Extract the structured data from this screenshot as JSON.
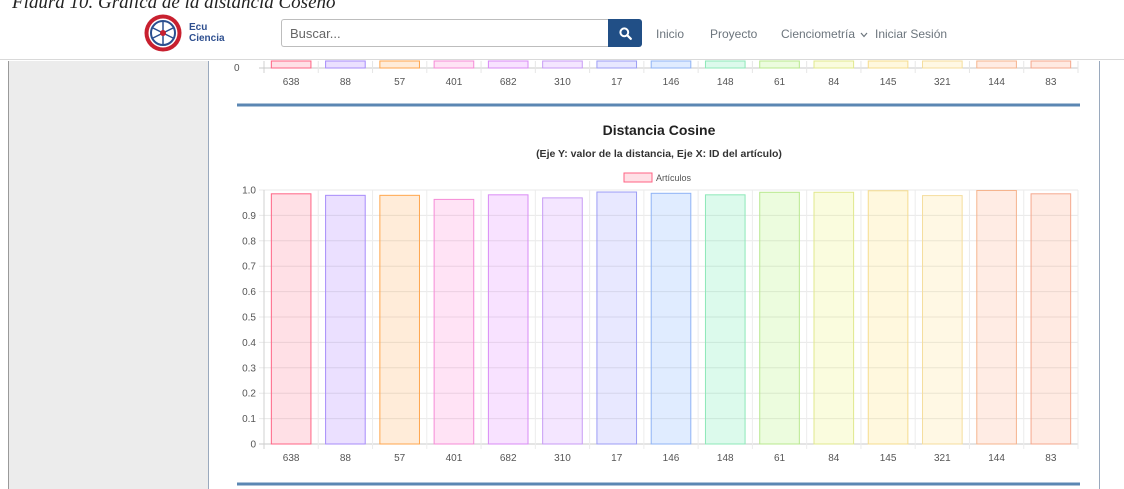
{
  "figure_caption": "Figura 10. Gráfica de la distancia Coseno",
  "navbar": {
    "logo_text_line1": "Ecu",
    "logo_text_line2": "Ciencia",
    "search_placeholder": "Buscar...",
    "links": {
      "inicio": "Inicio",
      "proyecto": "Proyecto",
      "cienciometria": "Cienciometría",
      "login": "Iniciar Sesión"
    },
    "icons": {
      "search": "search-icon",
      "dropdown": "chevron-down-icon"
    },
    "accent_color": "#214f86"
  },
  "top_chart_fragment": {
    "y_tick_label": "0",
    "categories": [
      "638",
      "88",
      "57",
      "401",
      "682",
      "310",
      "17",
      "146",
      "148",
      "61",
      "84",
      "145",
      "321",
      "144",
      "83"
    ]
  },
  "chart_data": {
    "type": "bar",
    "title": "Distancia Cosine",
    "subtitle": "(Eje Y: valor de la distancia, Eje X: ID del artículo)",
    "legend": [
      "Artículos"
    ],
    "legend_position": "top-center",
    "categories": [
      "638",
      "88",
      "57",
      "401",
      "682",
      "310",
      "17",
      "146",
      "148",
      "61",
      "84",
      "145",
      "321",
      "144",
      "83"
    ],
    "series": [
      {
        "name": "Artículos",
        "values": [
          0.985,
          0.979,
          0.979,
          0.963,
          0.981,
          0.969,
          0.992,
          0.987,
          0.981,
          0.991,
          0.991,
          0.997,
          0.978,
          0.998,
          0.985
        ]
      }
    ],
    "ylim": [
      0,
      1.0
    ],
    "yticks": [
      "0",
      "0.1",
      "0.2",
      "0.3",
      "0.4",
      "0.5",
      "0.6",
      "0.7",
      "0.8",
      "0.9",
      "1.0"
    ],
    "grid": true,
    "colors": {
      "fills": [
        "rgba(255,99,132,0.2)",
        "rgba(153,102,255,0.2)",
        "rgba(255,159,64,0.2)",
        "rgba(255,99,200,0.18)",
        "rgba(220,110,255,0.2)",
        "rgba(200,130,255,0.2)",
        "rgba(140,140,255,0.2)",
        "rgba(100,160,255,0.2)",
        "rgba(80,230,160,0.2)",
        "rgba(160,240,90,0.2)",
        "rgba(230,240,90,0.2)",
        "rgba(255,220,90,0.2)",
        "rgba(255,220,120,0.2)",
        "rgba(255,160,120,0.2)",
        "rgba(255,150,110,0.2)"
      ],
      "borders": [
        "#ff6384",
        "#a78bfa",
        "#ffa64d",
        "#f58bd6",
        "#d98bf5",
        "#c79bf5",
        "#9d9df5",
        "#8fb3f5",
        "#8ee8b8",
        "#b8e88e",
        "#e0e88e",
        "#f5dc8e",
        "#f5dd9d",
        "#f5b48e",
        "#f5a88e"
      ]
    },
    "separator_color": "#5b87b3"
  }
}
